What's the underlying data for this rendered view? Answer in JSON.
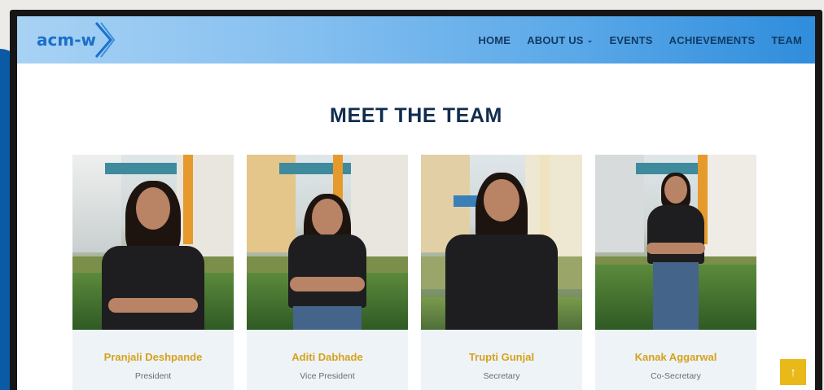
{
  "logo": {
    "text": "acm-w"
  },
  "nav": {
    "items": [
      {
        "label": "HOME"
      },
      {
        "label": "ABOUT US",
        "has_dropdown": true
      },
      {
        "label": "EVENTS"
      },
      {
        "label": "ACHIEVEMENTS"
      },
      {
        "label": "TEAM"
      }
    ],
    "dropdown_glyph": "⌄"
  },
  "section": {
    "title": "MEET THE TEAM"
  },
  "team": [
    {
      "name": "Pranjali Deshpande",
      "role": "President"
    },
    {
      "name": "Aditi Dabhade",
      "role": "Vice President"
    },
    {
      "name": "Trupti Gunjal",
      "role": "Secretary"
    },
    {
      "name": "Kanak Aggarwal",
      "role": "Co-Secretary"
    }
  ],
  "scroll_top": {
    "glyph": "↑"
  },
  "colors": {
    "nav_text": "#123a63",
    "title": "#112d4e",
    "name_accent": "#d6a21c",
    "scroll_button": "#e9b91a",
    "logo_blue": "#1c6fc9"
  }
}
